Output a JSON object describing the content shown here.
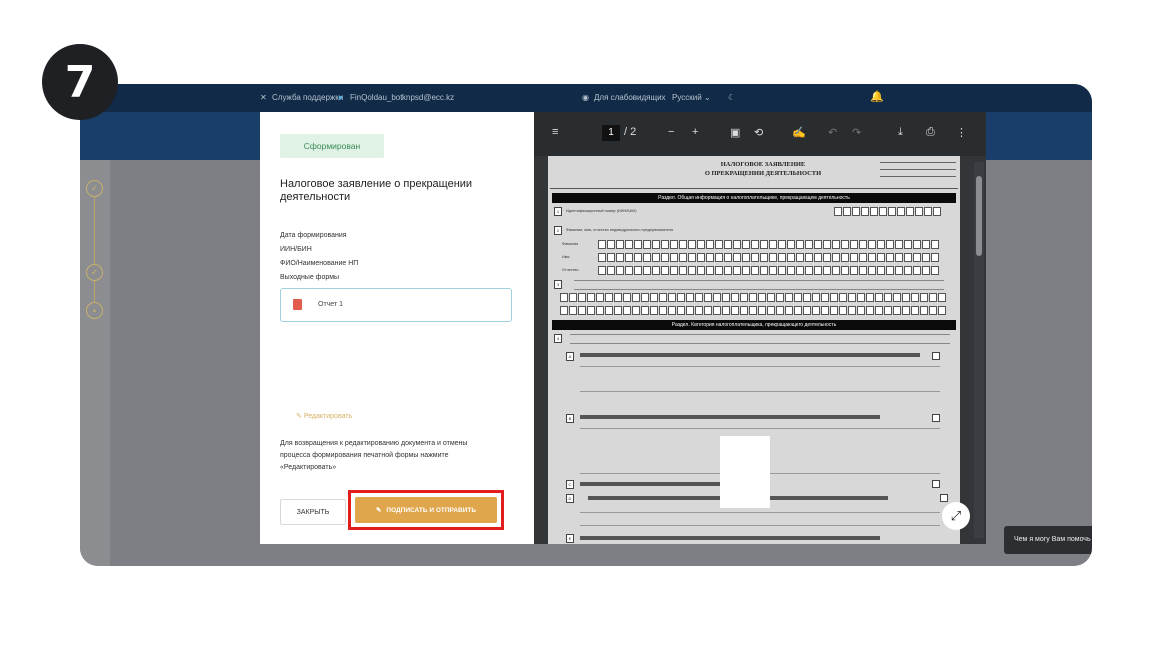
{
  "step_number": "7",
  "topbar": {
    "support_label": "Служба поддержки",
    "bot_label": "FinQoldau_bot",
    "email": "knpsd@ecc.kz",
    "accessibility_label": "Для слабовидящих",
    "language": "Русский",
    "icons": [
      "close-x-icon",
      "telegram-icon",
      "eye-icon",
      "chevron-down-icon",
      "moon-icon",
      "bell-icon"
    ]
  },
  "panel": {
    "status_badge": "Сформирован",
    "title": "Налоговое заявление о прекращении деятельности",
    "fields": [
      "Дата формирования",
      "ИИН/БИН",
      "ФИО/Наименование НП",
      "Выходные формы"
    ],
    "report_label": "Отчет 1",
    "edit_label": "Редактировать",
    "hint": "Для возвращения к редактированию документа и отмены процесса формирования печатной формы нажмите «Редактировать»",
    "close_button": "ЗАКРЫТЬ",
    "sign_button": "ПОДПИСАТЬ И ОТПРАВИТЬ"
  },
  "viewer": {
    "current_page": "1",
    "total_pages": "/ 2",
    "doc_heading_line1": "НАЛОГОВОЕ ЗАЯВЛЕНИЕ",
    "doc_heading_line2": "О ПРЕКРАЩЕНИИ ДЕЯТЕЛЬНОСТИ",
    "section1": "Раздел. Общая информация о налогоплательщике, прекращающем деятельность",
    "section2": "Раздел. Категория налогоплательщика, прекращающего деятельность",
    "row1": "Идентификационный номер (ИИН/БИН)",
    "row2": "Фамилия, имя, отчество индивидуального предпринимателя",
    "surname": "Фамилия",
    "name": "Имя",
    "patronymic": "Отчество"
  },
  "chat": {
    "text": "Чем я могу Вам помочь"
  },
  "colors": {
    "topbar": "#102a47",
    "accent_gold": "#e0a64b",
    "status_green": "#dff2e5",
    "highlight_red": "#e11d1d"
  }
}
